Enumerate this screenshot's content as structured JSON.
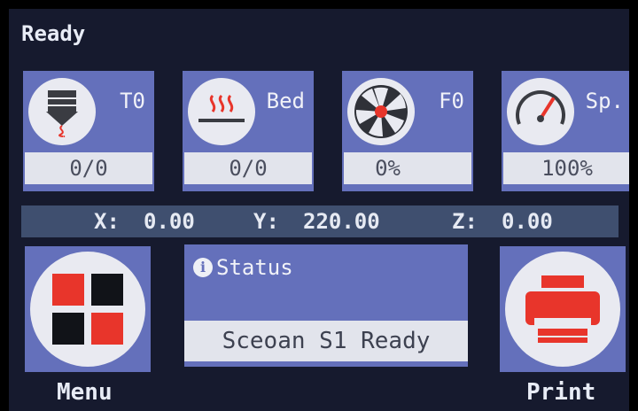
{
  "status_text": "Ready",
  "tiles": [
    {
      "label": "T0",
      "value": "0/0",
      "icon": "nozzle-icon"
    },
    {
      "label": "Bed",
      "value": "0/0",
      "icon": "heated-bed-icon"
    },
    {
      "label": "F0",
      "value": "0%",
      "icon": "fan-icon"
    },
    {
      "label": "Sp.",
      "value": "100%",
      "icon": "speed-gauge-icon"
    }
  ],
  "coords": {
    "x_label": "X:",
    "x_value": "0.00",
    "y_label": "Y:",
    "y_value": "220.00",
    "z_label": "Z:",
    "z_value": "0.00"
  },
  "menu": {
    "label": "Menu",
    "icon": "menu-grid-icon"
  },
  "status_panel": {
    "title": "Status",
    "info_glyph": "i",
    "message": "Sceoan S1 Ready"
  },
  "print": {
    "label": "Print",
    "icon": "printer-icon"
  },
  "colors": {
    "tile_bg": "#6470bb",
    "screen_bg": "#161a2e",
    "value_bg": "#e2e4ec",
    "accent_red": "#e8352b",
    "coords_bar": "#3f4f6f"
  }
}
